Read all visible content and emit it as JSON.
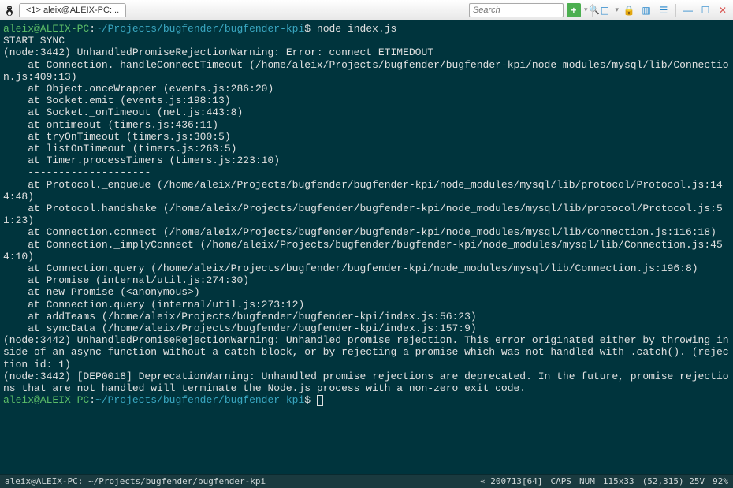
{
  "titlebar": {
    "tab_label": "<1> aleix@ALEIX-PC:..."
  },
  "search": {
    "placeholder": "Search"
  },
  "prompt": {
    "user": "aleix@ALEIX-PC",
    "sep": ":",
    "path": "~/Projects/bugfender/bugfender-kpi",
    "sym": "$",
    "command": "node index.js"
  },
  "output": {
    "lines": [
      "START SYNC",
      "(node:3442) UnhandledPromiseRejectionWarning: Error: connect ETIMEDOUT",
      "    at Connection._handleConnectTimeout (/home/aleix/Projects/bugfender/bugfender-kpi/node_modules/mysql/lib/Connection.js:409:13)",
      "    at Object.onceWrapper (events.js:286:20)",
      "    at Socket.emit (events.js:198:13)",
      "    at Socket._onTimeout (net.js:443:8)",
      "    at ontimeout (timers.js:436:11)",
      "    at tryOnTimeout (timers.js:300:5)",
      "    at listOnTimeout (timers.js:263:5)",
      "    at Timer.processTimers (timers.js:223:10)",
      "    --------------------",
      "    at Protocol._enqueue (/home/aleix/Projects/bugfender/bugfender-kpi/node_modules/mysql/lib/protocol/Protocol.js:144:48)",
      "    at Protocol.handshake (/home/aleix/Projects/bugfender/bugfender-kpi/node_modules/mysql/lib/protocol/Protocol.js:51:23)",
      "    at Connection.connect (/home/aleix/Projects/bugfender/bugfender-kpi/node_modules/mysql/lib/Connection.js:116:18)",
      "    at Connection._implyConnect (/home/aleix/Projects/bugfender/bugfender-kpi/node_modules/mysql/lib/Connection.js:454:10)",
      "    at Connection.query (/home/aleix/Projects/bugfender/bugfender-kpi/node_modules/mysql/lib/Connection.js:196:8)",
      "    at Promise (internal/util.js:274:30)",
      "    at new Promise (<anonymous>)",
      "    at Connection.query (internal/util.js:273:12)",
      "    at addTeams (/home/aleix/Projects/bugfender/bugfender-kpi/index.js:56:23)",
      "    at syncData (/home/aleix/Projects/bugfender/bugfender-kpi/index.js:157:9)",
      "(node:3442) UnhandledPromiseRejectionWarning: Unhandled promise rejection. This error originated either by throwing inside of an async function without a catch block, or by rejecting a promise which was not handled with .catch(). (rejection id: 1)",
      "(node:3442) [DEP0018] DeprecationWarning: Unhandled promise rejections are deprecated. In the future, promise rejections that are not handled will terminate the Node.js process with a non-zero exit code."
    ]
  },
  "statusbar": {
    "left": "aleix@ALEIX-PC: ~/Projects/bugfender/bugfender-kpi",
    "buf": "« 200713[64]",
    "caps": "CAPS",
    "num": "NUM",
    "size": "115x33",
    "pos": "(52,315) 25V",
    "pct": "92%"
  }
}
